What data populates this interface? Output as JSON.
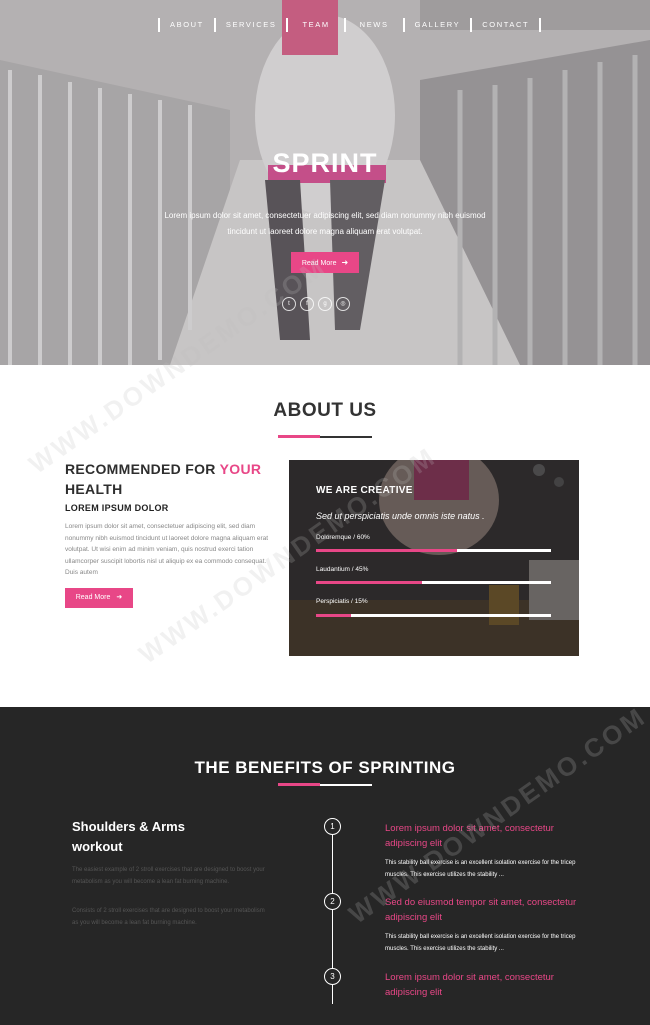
{
  "nav": {
    "items": [
      "ABOUT",
      "SERVICES",
      "TEAM",
      "NEWS",
      "GALLERY",
      "CONTACT"
    ]
  },
  "hero": {
    "title": "SPRINT",
    "text": "Lorem ipsum dolor sit amet, consectetuer adipiscing elit, sed diam nonummy nibh euismod tincidunt ut laoreet dolore magna aliquam erat volutpat.",
    "button": "Read More",
    "socials": [
      "twitter-icon",
      "facebook-icon",
      "google-plus-icon",
      "dribbble-icon"
    ]
  },
  "about": {
    "title": "ABOUT US",
    "heading_main": "RECOMMENDED FOR",
    "heading_accent": "YOUR",
    "heading_rest": "HEALTH",
    "subheading": "LOREM IPSUM DOLOR",
    "text": "Lorem ipsum dolor sit amet, consectetuer adipiscing elit, sed diam nonummy nibh euismod tincidunt ut laoreet dolore magna aliquam erat volutpat. Ut wisi enim ad minim veniam, quis nostrud exerci tation ullamcorper suscipit lobortis nisl ut aliquip ex ea commodo consequat. Duis autem",
    "button": "Read More",
    "creative": {
      "title": "WE ARE CREATIVE",
      "quote": "Sed ut perspiciatis unde omnis iste natus .",
      "skills": [
        {
          "label": "Doloremque / 60%",
          "value": 0.6
        },
        {
          "label": "Laudantium / 45%",
          "value": 0.45
        },
        {
          "label": "Perspiciatis / 15%",
          "value": 0.15
        }
      ]
    }
  },
  "benefits": {
    "title": "THE BENEFITS OF SPRINTING",
    "left_title": "Shoulders & Arms workout",
    "left_paragraphs": [
      "The easiest example of 2 stroll exercises that are designed to boost your metabolism as you will become a lean fat burning machine.",
      "Consists of 2 stroll exercises that are designed to boost your metabolism as you will become a lean fat burning machine."
    ],
    "timeline": [
      {
        "num": "1",
        "heading": "Lorem ipsum dolor sit amet, consectetur adipiscing elit",
        "text": "This stability ball exercise is an excellent isolation exercise for the tricep muscles. This exercise utilizes the stability ..."
      },
      {
        "num": "2",
        "heading": "Sed do eiusmod tempor sit amet, consectetur adipiscing elit",
        "text": "This stability ball exercise is an excellent isolation exercise for the tricep muscles. This exercise utilizes the stability ..."
      },
      {
        "num": "3",
        "heading": "Lorem ipsum dolor sit amet, consectetur adipiscing elit",
        "text": ""
      }
    ]
  },
  "watermark": "WWW.DOWNDEMO.COM",
  "colors": {
    "accent": "#e84787",
    "dark_bg": "#262626",
    "heading": "#333333"
  }
}
